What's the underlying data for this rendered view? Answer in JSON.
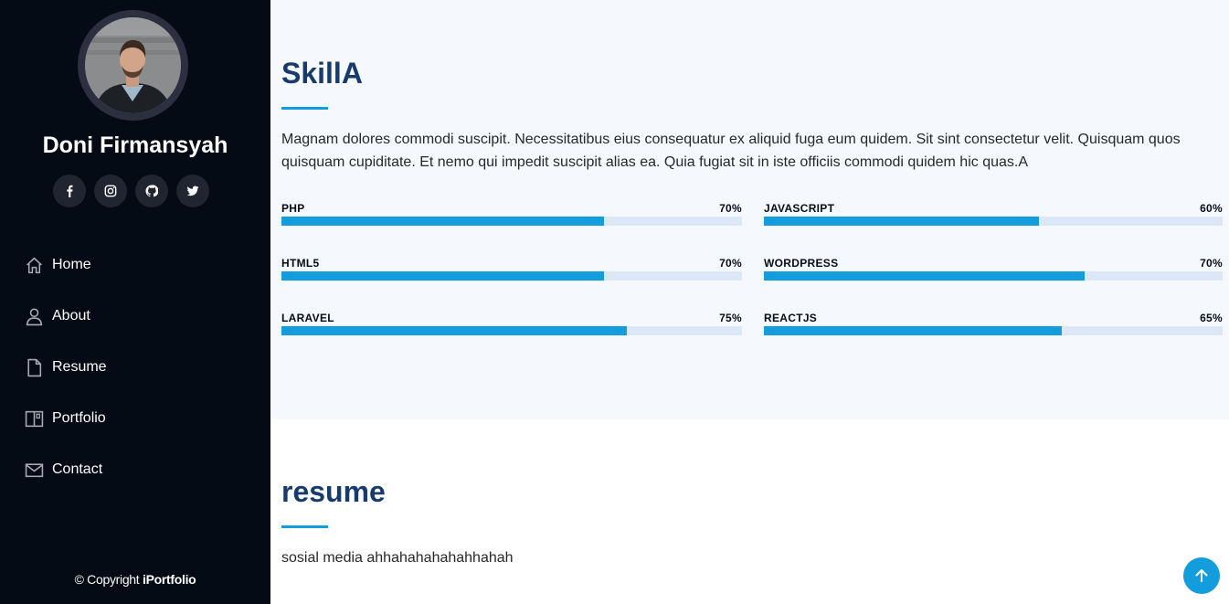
{
  "profile": {
    "name": "Doni Firmansyah",
    "social": [
      {
        "icon": "facebook-icon",
        "label": "f"
      },
      {
        "icon": "instagram-icon",
        "label": ""
      },
      {
        "icon": "github-icon",
        "label": ""
      },
      {
        "icon": "twitter-icon",
        "label": ""
      }
    ]
  },
  "nav": {
    "items": [
      {
        "icon": "home-icon",
        "label": "Home"
      },
      {
        "icon": "person-icon",
        "label": "About"
      },
      {
        "icon": "file-icon",
        "label": "Resume"
      },
      {
        "icon": "book-icon",
        "label": "Portfolio"
      },
      {
        "icon": "envelope-icon",
        "label": "Contact"
      }
    ]
  },
  "footer": {
    "prefix": "© Copyright ",
    "brand": "iPortfolio"
  },
  "skills": {
    "title": "SkillA",
    "text": "Magnam dolores commodi suscipit. Necessitatibus eius consequatur ex aliquid fuga eum quidem. Sit sint consectetur velit. Quisquam quos quisquam cupiditate. Et nemo qui impedit suscipit alias ea. Quia fugiat sit in iste officiis commodi quidem hic quas.A",
    "items": [
      {
        "name": "PHP",
        "value": "70%",
        "percent": 70
      },
      {
        "name": "JAVASCRIPT",
        "value": "60%",
        "percent": 60
      },
      {
        "name": "HTML5",
        "value": "70%",
        "percent": 70
      },
      {
        "name": "WORDPRESS",
        "value": "70%",
        "percent": 70
      },
      {
        "name": "LARAVEL",
        "value": "75%",
        "percent": 75
      },
      {
        "name": "REACTJS",
        "value": "65%",
        "percent": 65
      }
    ]
  },
  "resume": {
    "title": "resume",
    "text": "sosial media ahhahahahahahhahah"
  },
  "colors": {
    "sidebar_bg": "#040b14",
    "accent": "#149ddd",
    "heading": "#173b6c",
    "section_bg": "#f5f8fd",
    "track": "#dce8f8"
  },
  "back_to_top": {
    "icon": "arrow-up-icon"
  }
}
